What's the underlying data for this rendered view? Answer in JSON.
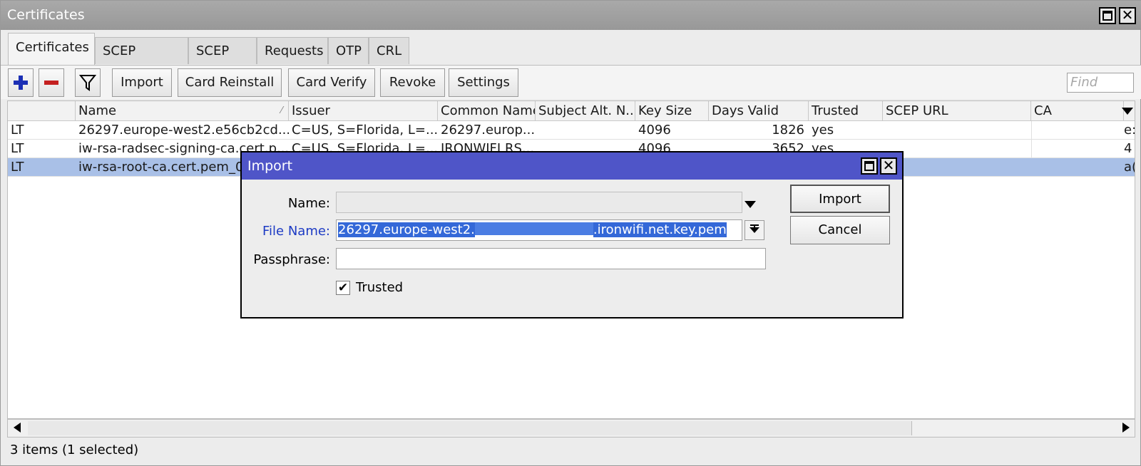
{
  "window": {
    "title": "Certificates",
    "maximize_icon": "maximize-icon",
    "close_icon": "close-icon"
  },
  "tabs": [
    {
      "label": "Certificates",
      "active": true
    },
    {
      "label": "SCEP Servers"
    },
    {
      "label": "SCEP RA"
    },
    {
      "label": "Requests"
    },
    {
      "label": "OTP"
    },
    {
      "label": "CRL"
    }
  ],
  "toolbar": {
    "add_icon": "plus-icon",
    "remove_icon": "minus-icon",
    "filter_icon": "filter-icon",
    "import_label": "Import",
    "card_reinstall_label": "Card Reinstall",
    "card_verify_label": "Card Verify",
    "revoke_label": "Revoke",
    "settings_label": "Settings",
    "find_placeholder": "Find"
  },
  "table": {
    "columns": [
      "",
      "Name",
      "Issuer",
      "Common Name",
      "Subject Alt. N...",
      "Key Size",
      "Days Valid",
      "Trusted",
      "SCEP URL",
      "CA"
    ],
    "rows": [
      {
        "flags": "LT",
        "name": "26297.europe-west2.e56cb2cd...",
        "issuer": "C=US, S=Florida, L=...",
        "common_name": "26297.europ...",
        "subject_alt": "",
        "key_size": "4096",
        "days_valid": "1826",
        "trusted": "yes",
        "scep_url": "",
        "ca": "",
        "extra": "e:"
      },
      {
        "flags": "LT",
        "name": "iw-rsa-radsec-signing-ca.cert.p...",
        "issuer": "C=US, S=Florida, L=...",
        "common_name": "IRONWIFI RS...",
        "subject_alt": "",
        "key_size": "4096",
        "days_valid": "3652",
        "trusted": "yes",
        "scep_url": "",
        "ca": "",
        "extra": "4"
      },
      {
        "flags": "LT",
        "name": "iw-rsa-root-ca.cert.pem_0",
        "issuer": "",
        "common_name": "",
        "subject_alt": "",
        "key_size": "",
        "days_valid": "",
        "trusted": "",
        "scep_url": "",
        "ca": "",
        "extra": "a(",
        "selected": true
      }
    ]
  },
  "status": "3 items (1 selected)",
  "dialog": {
    "title": "Import",
    "name_label": "Name:",
    "name_value": "",
    "file_name_label": "File Name:",
    "file_name_prefix": "26297.europe-west2.",
    "file_name_suffix": ".ironwifi.net.key.pem",
    "passphrase_label": "Passphrase:",
    "passphrase_value": "",
    "trusted_label": "Trusted",
    "trusted_checked": true,
    "import_button": "Import",
    "cancel_button": "Cancel"
  },
  "colors": {
    "dialog_title_bg": "#4f55c8",
    "selection_row": "#a9c0e7",
    "file_name_label": "#1d3bc4",
    "text_selection": "#3468d8"
  }
}
